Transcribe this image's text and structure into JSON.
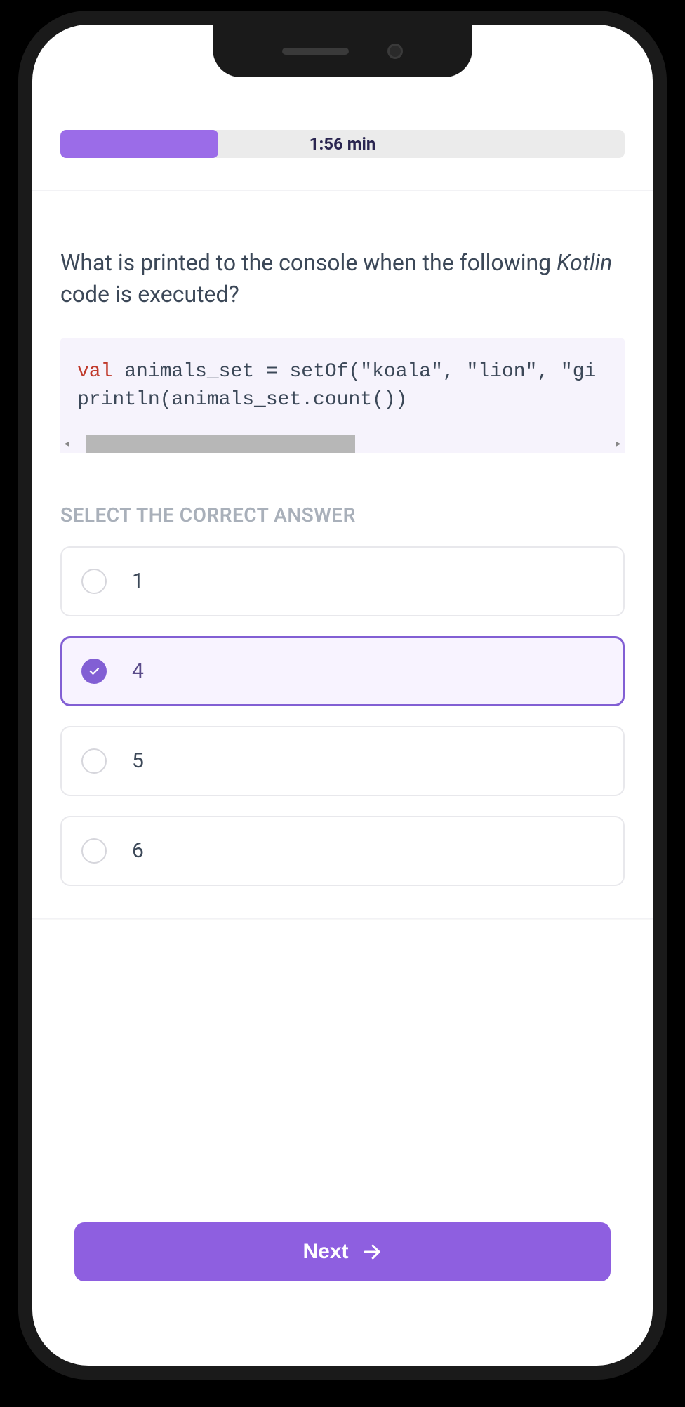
{
  "timer": {
    "display": "1:56 min",
    "progress_pct": 28
  },
  "question": {
    "prefix": "What is printed to the console when the following ",
    "lang": "Kotlin",
    "suffix": " code is executed?"
  },
  "code": {
    "line1_keyword": "val",
    "line1_rest": " animals_set = setOf(\"koala\", \"lion\", \"gi",
    "line2": "println(animals_set.count())"
  },
  "instruction": "SELECT THE CORRECT ANSWER",
  "options": [
    {
      "label": "1",
      "selected": false
    },
    {
      "label": "4",
      "selected": true
    },
    {
      "label": "5",
      "selected": false
    },
    {
      "label": "6",
      "selected": false
    }
  ],
  "next_button": "Next",
  "colors": {
    "accent": "#8e5fe0",
    "accent_light": "#9b6ce8",
    "selected_border": "#825fd4"
  }
}
